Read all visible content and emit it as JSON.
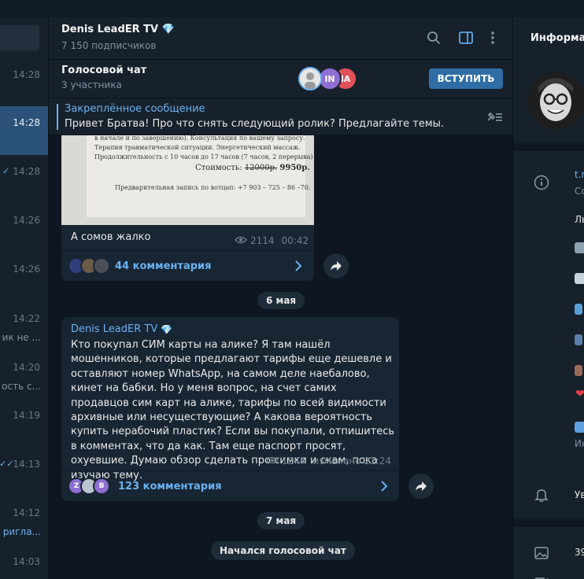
{
  "chat_list": {
    "times": [
      "14:28",
      "14:28",
      "14:28",
      "14:26",
      "14:26",
      "14:22",
      "14:20",
      "14:19",
      "14:13",
      "14:12",
      "14:03"
    ],
    "snippets": [
      "ик не ...",
      "ость с...",
      "ригла..."
    ]
  },
  "header": {
    "title": "Denis LeadER TV",
    "subscribers": "7 150 подписчиков",
    "icons": [
      "search-icon",
      "sidebar-toggle-icon",
      "more-vertical-icon",
      "diamond-icon"
    ]
  },
  "voice_chat": {
    "title": "Голосовой чат",
    "participants": "3 участника",
    "avatar_labels": [
      "IN",
      "IA"
    ],
    "join_label": "ВСТУПИТЬ",
    "colors": {
      "join": "#2f6ea5",
      "avatar_in": "#8e6fd1",
      "avatar_ia": "#e0515a"
    }
  },
  "pinned": {
    "title": "Закреплённое сообщение",
    "text": "Привет Братва! Про что снять следующий ролик? Предлагайте темы."
  },
  "messages": [
    {
      "photo_text": {
        "line1": "в начале и по завершению). Консультация по вашему запросу.",
        "line2": "Терапия травматической ситуации. Энергетический массаж.",
        "line3": "Продолжительность с 10 часов до 17 часов (7 часов, 2 перерыва)",
        "price_label": "Стоимость:",
        "price_old": "12000р.",
        "price_new": "9950р.",
        "line5": "Предварительная запись по вотцап: +7 903 – 725 – 86 –70."
      },
      "caption": "А сомов жалко",
      "views": "2114",
      "time": "00:42",
      "comments": "44 комментария"
    },
    {
      "date": "6 мая",
      "sender": "Denis LeadER TV",
      "text": "Кто покупал СИМ карты на алике? Я там нашёл мошенников, которые предлагают тарифы еще дешевле и оставляют номер WhatsApp, на самом деле наебалово, кинет на бабки. Но у меня вопрос, на счет самих продавцов сим карт на алике, тарифы по всей видимости архивные или несуществующие? А какова вероятность купить нерабочий пластик? Если вы покупали, отпишитесь в комментах, что да как. Там еще паспорт просят, охуевшие. Думаю обзор сделать про симки и скам, пока изучаю тему.",
      "views": "1244",
      "edited": "изменено 21:24",
      "comment_avatars": [
        "Z",
        "B"
      ],
      "comments": "123 комментария"
    }
  ],
  "date2": "7 мая",
  "service": "Начался голосовой чат",
  "right_panel": {
    "title": "Информац",
    "link": "t.m",
    "link_sub": "Сс",
    "desc": "Ль",
    "notif": "Ув",
    "media_count": "39",
    "about_sub": "Ин"
  }
}
